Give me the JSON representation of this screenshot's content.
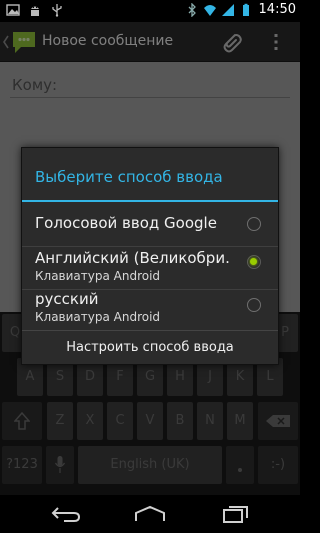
{
  "status_bar": {
    "time": "14:50",
    "left_icons": [
      "gallery-icon",
      "android-debug-icon",
      "usb-icon"
    ],
    "right_icons": [
      "bluetooth-icon",
      "wifi-icon",
      "signal-icon",
      "battery-icon"
    ]
  },
  "action_bar": {
    "title": "Новое сообщение",
    "icons": [
      "back-caret-icon",
      "messaging-app-icon",
      "attach-icon",
      "overflow-menu-icon"
    ]
  },
  "compose": {
    "to_placeholder": "Кому:"
  },
  "dialog": {
    "title": "Выберите способ ввода",
    "accent_color": "#33b5e5",
    "selected_color": "#99cc00",
    "options": [
      {
        "label": "Голосовой ввод Google",
        "subtitle": "",
        "selected": false
      },
      {
        "label": "Английский (Великобри.",
        "subtitle": "Клавиатура Android",
        "selected": true
      },
      {
        "label": "русский",
        "subtitle": "Клавиатура Android",
        "selected": false
      }
    ],
    "configure_label": "Настроить способ ввода"
  },
  "keyboard": {
    "row1": [
      "Q",
      "W",
      "E",
      "R",
      "T",
      "Y",
      "U",
      "I",
      "O",
      "P"
    ],
    "row2": [
      "A",
      "S",
      "D",
      "F",
      "G",
      "H",
      "J",
      "K",
      "L"
    ],
    "row3": [
      "Z",
      "X",
      "C",
      "V",
      "B",
      "N",
      "M"
    ],
    "symbols_label": "?123",
    "space_label": "English (UK)",
    "emoticon_label": ":-)"
  },
  "nav_bar": {
    "icons": [
      "back-icon",
      "home-icon",
      "recent-apps-icon"
    ]
  }
}
